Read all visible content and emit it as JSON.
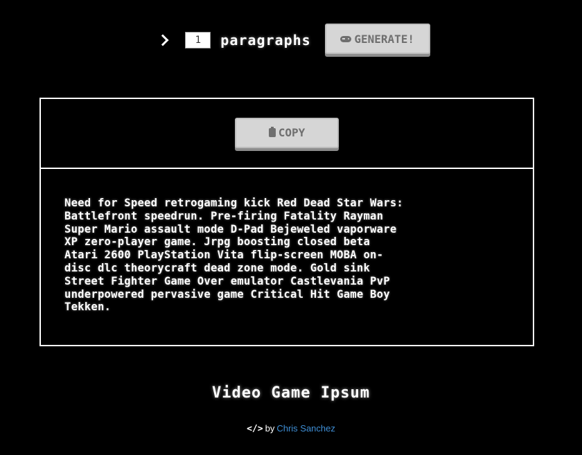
{
  "controls": {
    "chevron_icon": "chevron-right-icon",
    "paragraph_count": "1",
    "unit_label": "paragraphs",
    "generate_label": "GENERATE!",
    "generate_icon": "gamepad-icon"
  },
  "output": {
    "copy_label": "COPY",
    "copy_icon": "clipboard-icon",
    "text": "Need for Speed retrogaming kick Red Dead Star Wars:\nBattlefront speedrun. Pre-firing Fatality Rayman\nSuper Mario assault mode D-Pad Bejeweled vaporware\nXP zero-player game. Jrpg boosting closed beta\nAtari 2600 PlayStation Vita flip-screen MOBA on-\ndisc dlc theorycraft dead zone mode. Gold sink\nStreet Fighter Game Over emulator Castlevania PvP\nunderpowered pervasive game Critical Hit Game Boy\nTekken."
  },
  "footer": {
    "title": "Video Game Ipsum",
    "code_icon": "code-icon",
    "code_glyph": "</>",
    "by_text": "by",
    "author": "Chris Sanchez"
  },
  "colors": {
    "background": "#000000",
    "text": "#ffffff",
    "button_bg": "#d6d6d6",
    "button_text": "#6f6f6f",
    "link": "#3f8fd6"
  }
}
